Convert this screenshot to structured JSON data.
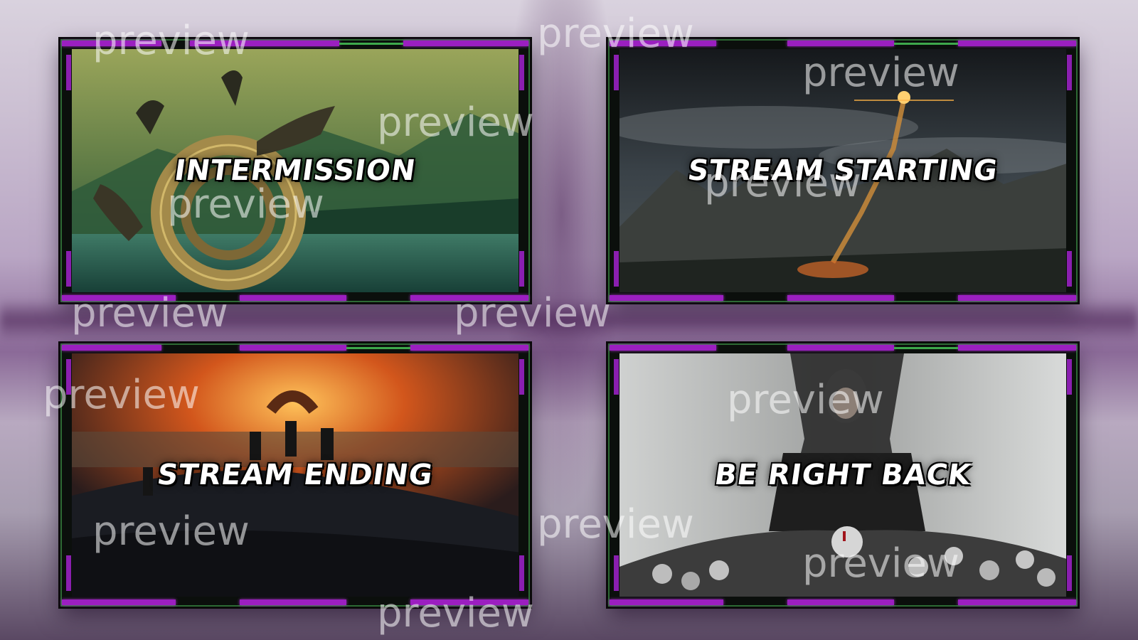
{
  "panels": [
    {
      "title": "INTERMISSION"
    },
    {
      "title": "STREAM STARTING"
    },
    {
      "title": "STREAM ENDING"
    },
    {
      "title": "BE RIGHT BACK"
    }
  ],
  "watermark": "preview",
  "colors": {
    "frame_purple": "#9b1fc0",
    "frame_green": "#3ea84b"
  }
}
